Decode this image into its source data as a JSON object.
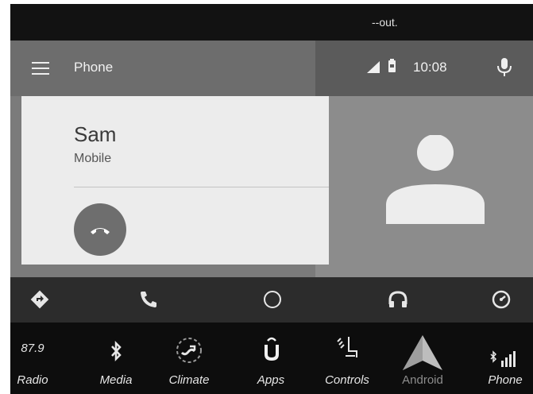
{
  "status_bar": {
    "text": "--out."
  },
  "app_bar": {
    "title": "Phone",
    "time": "10:08"
  },
  "call": {
    "contact_name": "Sam",
    "contact_type": "Mobile"
  },
  "icons": {
    "menu": "hamburger-menu-icon",
    "signal": "signal-icon",
    "battery": "battery-icon",
    "mic": "microphone-icon",
    "hangup": "phone-hangup-icon",
    "avatar": "person-avatar-icon",
    "nav": [
      "navigation-icon",
      "phone-icon",
      "home-circle-icon",
      "headphones-icon",
      "speedometer-icon"
    ]
  },
  "dock": {
    "radio_frequency": "87.9",
    "items": [
      {
        "label": "Radio"
      },
      {
        "label": "Media"
      },
      {
        "label": "Climate"
      },
      {
        "label": "Apps"
      },
      {
        "label": "Controls"
      },
      {
        "label": "Android"
      },
      {
        "label": "Phone"
      }
    ]
  },
  "colors": {
    "app_bar": "#6d6d6d",
    "card": "#ececec",
    "navbar": "#2c2c2c",
    "dock": "#0d0d0d"
  }
}
